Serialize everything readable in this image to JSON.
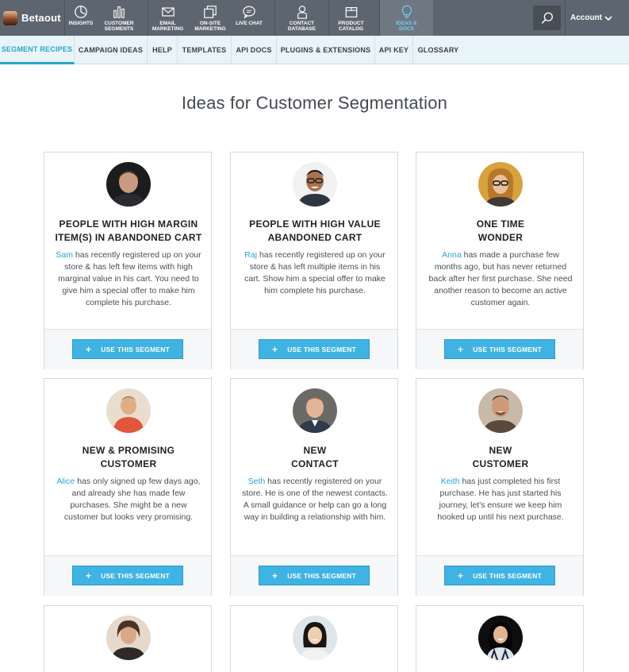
{
  "brand": {
    "name": "Betaout"
  },
  "topnav": {
    "items": [
      {
        "label": "INSIGHTS",
        "icon": "insights-icon"
      },
      {
        "label": "CUSTOMER SEGMENTS",
        "icon": "bar-chart-icon"
      },
      {
        "label": "EMAIL MARKETING",
        "icon": "envelope-icon"
      },
      {
        "label": "ON-SITE MARKETING",
        "icon": "windows-icon"
      },
      {
        "label": "LIVE CHAT",
        "icon": "chat-bubble-icon"
      },
      {
        "label": "CONTACT DATABASE",
        "icon": "person-icon"
      },
      {
        "label": "PRODUCT CATALOG",
        "icon": "box-icon"
      },
      {
        "label": "IDEAS & DOCS",
        "icon": "lightbulb-icon"
      }
    ],
    "account_label": "Account"
  },
  "subnav": {
    "tabs": [
      "SEGMENT RECIPES",
      "CAMPAIGN IDEAS",
      "HELP",
      "TEMPLATES",
      "API DOCS",
      "PLUGINS & EXTENSIONS",
      "API KEY",
      "GLOSSARY"
    ]
  },
  "page": {
    "title": "Ideas for Customer Segmentation"
  },
  "cards": [
    {
      "title_line1": "PEOPLE WITH HIGH MARGIN",
      "title_line2": "ITEM(S) IN ABANDONED CART",
      "name": "Sam",
      "desc": " has recently registered up on your store & has left few items with high marginal value in his cart. You need to give him a special offer to make him complete his purchase.",
      "button": "USE THIS SEGMENT"
    },
    {
      "title_line1": "PEOPLE WITH HIGH VALUE",
      "title_line2": "ABANDONED CART",
      "name": "Raj",
      "desc": " has recently registered up on your store & has left multiple items in his cart. Show him a special offer to make him complete his purchase.",
      "button": "USE THIS SEGMENT"
    },
    {
      "title_line1": "ONE TIME",
      "title_line2": "WONDER",
      "name": "Anna",
      "desc": " has made a purchase few months ago, but has never returned back after her first purchase. She need another reason to become an active customer again.",
      "button": "USE THIS SEGMENT"
    },
    {
      "title_line1": "NEW & PROMISING",
      "title_line2": "CUSTOMER",
      "name": "Alice",
      "desc": " has only signed up few days ago, and already she has made few purchases. She might be a new customer but looks very promising.",
      "button": "USE THIS SEGMENT"
    },
    {
      "title_line1": "NEW",
      "title_line2": "CONTACT",
      "name": "Seth",
      "desc": " has recently registered on your store. He is one of the newest contacts. A small guidance or help can go a long way in building a relationship with him.",
      "button": "USE THIS SEGMENT"
    },
    {
      "title_line1": "NEW",
      "title_line2": "CUSTOMER",
      "name": "Keith",
      "desc": " has just completed his first purchase. He has just started his journey, let's ensure we keep him hooked up until his next purchase.",
      "button": "USE THIS SEGMENT"
    }
  ],
  "colors": {
    "topbar": "#5d6670",
    "accent": "#2aa4cf",
    "button": "#3fb3e3"
  }
}
